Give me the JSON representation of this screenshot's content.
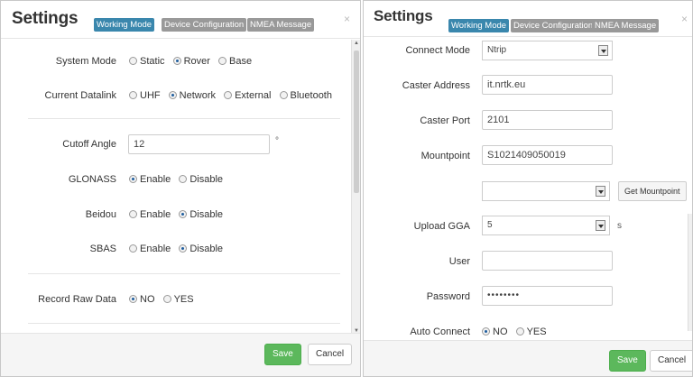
{
  "dialog_left": {
    "title": "Settings",
    "tabs": [
      "Working Mode",
      "Device Configuration",
      "NMEA Message"
    ],
    "close_icon": "×",
    "fields": {
      "system_mode": {
        "label": "System Mode",
        "options": [
          "Static",
          "Rover",
          "Base"
        ],
        "selected": "Rover"
      },
      "current_datalink": {
        "label": "Current Datalink",
        "options": [
          "UHF",
          "Network",
          "External",
          "Bluetooth"
        ],
        "selected": "Network"
      },
      "cutoff_angle": {
        "label": "Cutoff Angle",
        "value": "12",
        "unit": "°"
      },
      "glonass": {
        "label": "GLONASS",
        "options": [
          "Enable",
          "Disable"
        ],
        "selected": "Enable"
      },
      "beidou": {
        "label": "Beidou",
        "options": [
          "Enable",
          "Disable"
        ],
        "selected": "Disable"
      },
      "sbas": {
        "label": "SBAS",
        "options": [
          "Enable",
          "Disable"
        ],
        "selected": "Disable"
      },
      "record_raw_data": {
        "label": "Record Raw Data",
        "options": [
          "NO",
          "YES"
        ],
        "selected": "NO"
      }
    },
    "footer": {
      "save": "Save",
      "cancel": "Cancel"
    }
  },
  "dialog_right": {
    "title": "Settings",
    "tabs": [
      "Working Mode",
      "Device Configuration",
      "NMEA Message"
    ],
    "close_icon": "×",
    "fields": {
      "connect_mode": {
        "label": "Connect Mode",
        "value": "Ntrip"
      },
      "caster_address": {
        "label": "Caster Address",
        "value": "it.nrtk.eu"
      },
      "caster_port": {
        "label": "Caster Port",
        "value": "2101"
      },
      "mountpoint": {
        "label": "Mountpoint",
        "value": "S1021409050019"
      },
      "mountpoint_list": {
        "value": "",
        "button": "Get Mountpoint"
      },
      "upload_gga": {
        "label": "Upload GGA",
        "value": "5",
        "unit": "s"
      },
      "user": {
        "label": "User",
        "value": ""
      },
      "password": {
        "label": "Password",
        "value": "••••••••"
      },
      "auto_connect": {
        "label": "Auto Connect",
        "options": [
          "NO",
          "YES"
        ],
        "selected": "NO"
      }
    },
    "footer": {
      "save": "Save",
      "cancel": "Cancel"
    }
  },
  "colors": {
    "tab_active": "#3a87ad",
    "tab_inactive": "#999999",
    "save": "#5cb85c"
  }
}
